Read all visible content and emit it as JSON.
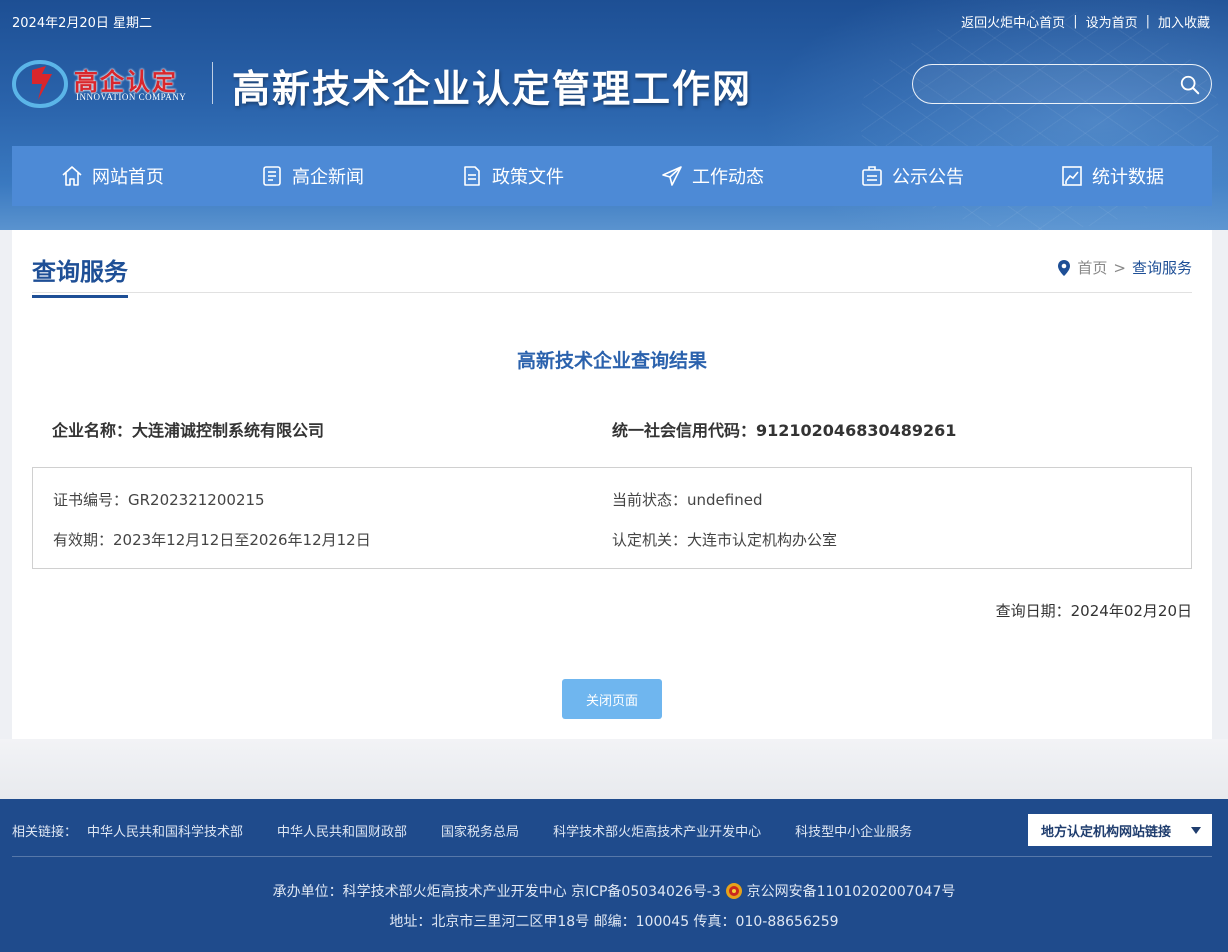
{
  "topbar": {
    "date": "2024年2月20日 星期二",
    "links": [
      "返回火炬中心首页",
      "设为首页",
      "加入收藏"
    ]
  },
  "logo": {
    "text": "高企认定",
    "sub": "INNOVATION COMPANY"
  },
  "site_title": "高新技术企业认定管理工作网",
  "search": {
    "placeholder": "",
    "icon": "search-icon"
  },
  "nav": [
    {
      "label": "网站首页",
      "icon": "home-icon"
    },
    {
      "label": "高企新闻",
      "icon": "news-icon"
    },
    {
      "label": "政策文件",
      "icon": "document-icon"
    },
    {
      "label": "工作动态",
      "icon": "paper-plane-icon"
    },
    {
      "label": "公示公告",
      "icon": "notice-icon"
    },
    {
      "label": "统计数据",
      "icon": "chart-icon"
    }
  ],
  "main": {
    "section_title": "查询服务",
    "breadcrumb": {
      "home": "首页",
      "sep": ">",
      "current": "查询服务"
    },
    "result_title": "高新技术企业查询结果",
    "company_name": "企业名称：大连浦诚控制系统有限公司",
    "credit_code": "统一社会信用代码：912102046830489261",
    "details": {
      "cert_no": "证书编号：GR202321200215",
      "status": "当前状态：undefined",
      "validity": "有效期：2023年12月12日至2026年12月12日",
      "authority": "认定机关：大连市认定机构办公室"
    },
    "query_date": "查询日期：2024年02月20日",
    "close_button": "关闭页面"
  },
  "footer": {
    "links_label": "相关链接：",
    "links": [
      "中华人民共和国科学技术部",
      "中华人民共和国财政部",
      "国家税务总局",
      "科学技术部火炬高技术产业开发中心",
      "科技型中小企业服务"
    ],
    "local_select": "地方认定机构网站链接",
    "line1_a": "承办单位：科学技术部火炬高技术产业开发中心 京ICP备05034026号-3",
    "line1_b": "京公网安备11010202007047号",
    "line2": "地址：北京市三里河二区甲18号 邮编：100045 传真：010-88656259"
  },
  "colors": {
    "nav": "#4d8ad6",
    "header_dark": "#1d4f94",
    "accent": "#1e4f96",
    "footer": "#1f4b8c",
    "button": "#6fb6ef"
  }
}
